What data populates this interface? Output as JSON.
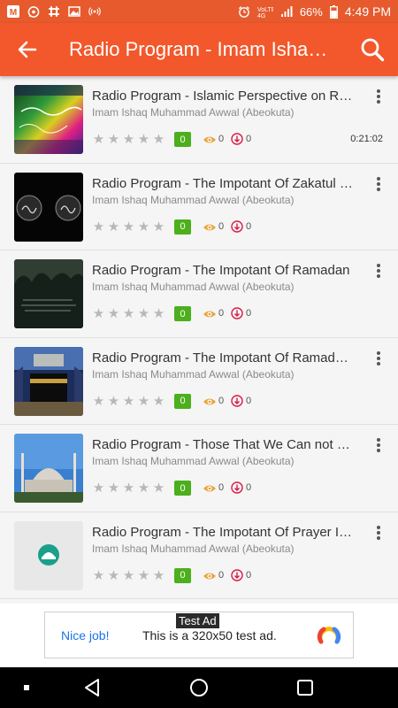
{
  "status_bar": {
    "battery": "66%",
    "time": "4:49 PM",
    "network": "4G",
    "icons_left": [
      "m-icon",
      "whatsapp-icon",
      "slack-icon",
      "image-icon",
      "hotspot-icon"
    ],
    "icons_right": [
      "alarm-icon",
      "volte-icon",
      "signal-icon",
      "battery-icon"
    ]
  },
  "app_bar": {
    "title": "Radio Program - Imam Ishaq Muhammad Awwal",
    "back_icon": "arrow-left-icon",
    "search_icon": "search-icon"
  },
  "list": {
    "items": [
      {
        "title": "Radio Program - Islamic Perspective on Ramadan",
        "author": "Imam Ishaq Muhammad Awwal (Abeokuta)",
        "rating": "0",
        "views": "0",
        "downloads": "0",
        "duration": "0:21:02",
        "thumb": "rainbow-calligraphy"
      },
      {
        "title": "Radio Program - The Impotant Of Zakatul Fitr",
        "author": "Imam Ishaq Muhammad Awwal (Abeokuta)",
        "rating": "0",
        "views": "0",
        "downloads": "0",
        "duration": "",
        "thumb": "black-calligraphy"
      },
      {
        "title": "Radio Program - The Impotant Of Ramadan",
        "author": "Imam Ishaq Muhammad Awwal (Abeokuta)",
        "rating": "0",
        "views": "0",
        "downloads": "0",
        "duration": "",
        "thumb": "dark-forest"
      },
      {
        "title": "Radio Program - The Impotant Of Ramadan Fasting",
        "author": "Imam Ishaq Muhammad Awwal (Abeokuta)",
        "rating": "0",
        "views": "0",
        "downloads": "0",
        "duration": "",
        "thumb": "kaaba"
      },
      {
        "title": "Radio Program - Those That We Can not Marry",
        "author": "Imam Ishaq Muhammad Awwal (Abeokuta)",
        "rating": "0",
        "views": "0",
        "downloads": "0",
        "duration": "",
        "thumb": "mosque"
      },
      {
        "title": "Radio Program - The Impotant Of Prayer In Islam",
        "author": "Imam Ishaq Muhammad Awwal (Abeokuta)",
        "rating": "0",
        "views": "0",
        "downloads": "0",
        "duration": "",
        "thumb": "placeholder-logo"
      }
    ]
  },
  "ad": {
    "label": "Test Ad",
    "nice": "Nice job!",
    "text": "This is a 320x50 test ad."
  },
  "nav_bar": {
    "buttons": [
      "menu-dot-icon",
      "back-triangle-icon",
      "home-circle-icon",
      "recents-square-icon"
    ]
  },
  "colors": {
    "app_bar": "#f2582b",
    "status_bar": "#e65a2d",
    "rating_badge": "#4caf1c",
    "views_icon": "#e8a33a",
    "download_icon": "#d81b45"
  }
}
